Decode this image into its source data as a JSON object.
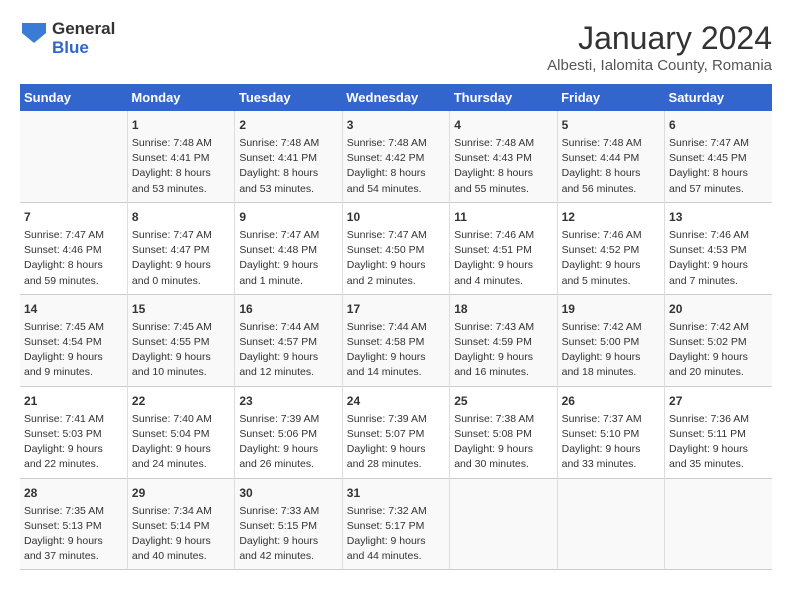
{
  "header": {
    "logo_general": "General",
    "logo_blue": "Blue",
    "title": "January 2024",
    "subtitle": "Albesti, Ialomita County, Romania"
  },
  "weekdays": [
    "Sunday",
    "Monday",
    "Tuesday",
    "Wednesday",
    "Thursday",
    "Friday",
    "Saturday"
  ],
  "weeks": [
    [
      {
        "num": "",
        "info": ""
      },
      {
        "num": "1",
        "info": "Sunrise: 7:48 AM\nSunset: 4:41 PM\nDaylight: 8 hours\nand 53 minutes."
      },
      {
        "num": "2",
        "info": "Sunrise: 7:48 AM\nSunset: 4:41 PM\nDaylight: 8 hours\nand 53 minutes."
      },
      {
        "num": "3",
        "info": "Sunrise: 7:48 AM\nSunset: 4:42 PM\nDaylight: 8 hours\nand 54 minutes."
      },
      {
        "num": "4",
        "info": "Sunrise: 7:48 AM\nSunset: 4:43 PM\nDaylight: 8 hours\nand 55 minutes."
      },
      {
        "num": "5",
        "info": "Sunrise: 7:48 AM\nSunset: 4:44 PM\nDaylight: 8 hours\nand 56 minutes."
      },
      {
        "num": "6",
        "info": "Sunrise: 7:47 AM\nSunset: 4:45 PM\nDaylight: 8 hours\nand 57 minutes."
      }
    ],
    [
      {
        "num": "7",
        "info": "Sunrise: 7:47 AM\nSunset: 4:46 PM\nDaylight: 8 hours\nand 59 minutes."
      },
      {
        "num": "8",
        "info": "Sunrise: 7:47 AM\nSunset: 4:47 PM\nDaylight: 9 hours\nand 0 minutes."
      },
      {
        "num": "9",
        "info": "Sunrise: 7:47 AM\nSunset: 4:48 PM\nDaylight: 9 hours\nand 1 minute."
      },
      {
        "num": "10",
        "info": "Sunrise: 7:47 AM\nSunset: 4:50 PM\nDaylight: 9 hours\nand 2 minutes."
      },
      {
        "num": "11",
        "info": "Sunrise: 7:46 AM\nSunset: 4:51 PM\nDaylight: 9 hours\nand 4 minutes."
      },
      {
        "num": "12",
        "info": "Sunrise: 7:46 AM\nSunset: 4:52 PM\nDaylight: 9 hours\nand 5 minutes."
      },
      {
        "num": "13",
        "info": "Sunrise: 7:46 AM\nSunset: 4:53 PM\nDaylight: 9 hours\nand 7 minutes."
      }
    ],
    [
      {
        "num": "14",
        "info": "Sunrise: 7:45 AM\nSunset: 4:54 PM\nDaylight: 9 hours\nand 9 minutes."
      },
      {
        "num": "15",
        "info": "Sunrise: 7:45 AM\nSunset: 4:55 PM\nDaylight: 9 hours\nand 10 minutes."
      },
      {
        "num": "16",
        "info": "Sunrise: 7:44 AM\nSunset: 4:57 PM\nDaylight: 9 hours\nand 12 minutes."
      },
      {
        "num": "17",
        "info": "Sunrise: 7:44 AM\nSunset: 4:58 PM\nDaylight: 9 hours\nand 14 minutes."
      },
      {
        "num": "18",
        "info": "Sunrise: 7:43 AM\nSunset: 4:59 PM\nDaylight: 9 hours\nand 16 minutes."
      },
      {
        "num": "19",
        "info": "Sunrise: 7:42 AM\nSunset: 5:00 PM\nDaylight: 9 hours\nand 18 minutes."
      },
      {
        "num": "20",
        "info": "Sunrise: 7:42 AM\nSunset: 5:02 PM\nDaylight: 9 hours\nand 20 minutes."
      }
    ],
    [
      {
        "num": "21",
        "info": "Sunrise: 7:41 AM\nSunset: 5:03 PM\nDaylight: 9 hours\nand 22 minutes."
      },
      {
        "num": "22",
        "info": "Sunrise: 7:40 AM\nSunset: 5:04 PM\nDaylight: 9 hours\nand 24 minutes."
      },
      {
        "num": "23",
        "info": "Sunrise: 7:39 AM\nSunset: 5:06 PM\nDaylight: 9 hours\nand 26 minutes."
      },
      {
        "num": "24",
        "info": "Sunrise: 7:39 AM\nSunset: 5:07 PM\nDaylight: 9 hours\nand 28 minutes."
      },
      {
        "num": "25",
        "info": "Sunrise: 7:38 AM\nSunset: 5:08 PM\nDaylight: 9 hours\nand 30 minutes."
      },
      {
        "num": "26",
        "info": "Sunrise: 7:37 AM\nSunset: 5:10 PM\nDaylight: 9 hours\nand 33 minutes."
      },
      {
        "num": "27",
        "info": "Sunrise: 7:36 AM\nSunset: 5:11 PM\nDaylight: 9 hours\nand 35 minutes."
      }
    ],
    [
      {
        "num": "28",
        "info": "Sunrise: 7:35 AM\nSunset: 5:13 PM\nDaylight: 9 hours\nand 37 minutes."
      },
      {
        "num": "29",
        "info": "Sunrise: 7:34 AM\nSunset: 5:14 PM\nDaylight: 9 hours\nand 40 minutes."
      },
      {
        "num": "30",
        "info": "Sunrise: 7:33 AM\nSunset: 5:15 PM\nDaylight: 9 hours\nand 42 minutes."
      },
      {
        "num": "31",
        "info": "Sunrise: 7:32 AM\nSunset: 5:17 PM\nDaylight: 9 hours\nand 44 minutes."
      },
      {
        "num": "",
        "info": ""
      },
      {
        "num": "",
        "info": ""
      },
      {
        "num": "",
        "info": ""
      }
    ]
  ]
}
